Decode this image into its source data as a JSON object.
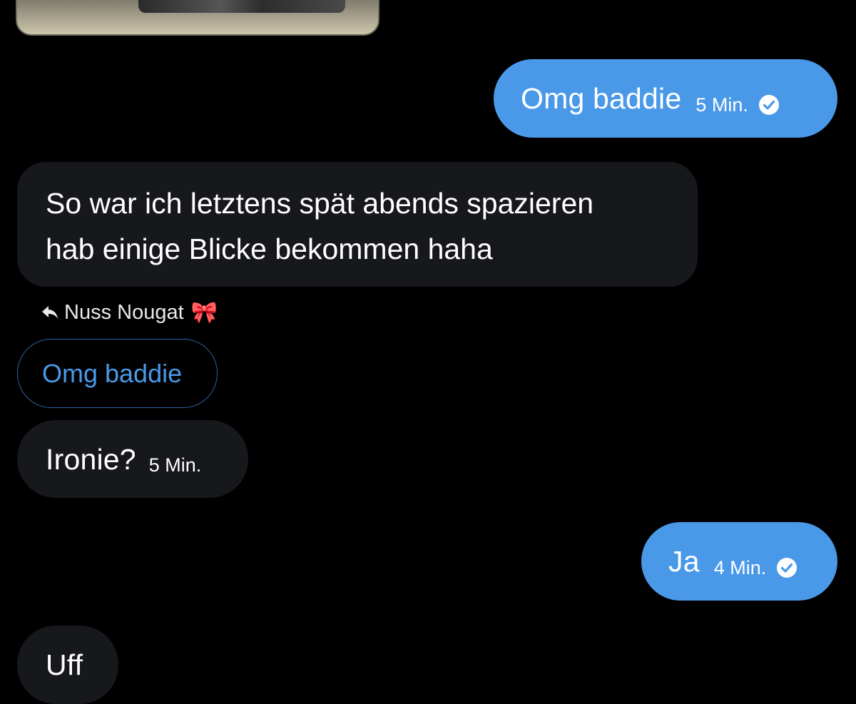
{
  "conversation": {
    "messages": [
      {
        "direction": "outgoing",
        "text": "Omg baddie",
        "time": "5 Min.",
        "status": "sent"
      },
      {
        "direction": "incoming",
        "text_lines": [
          "So war ich letztens spät abends spazieren",
          "hab einige Blicke bekommen haha"
        ]
      },
      {
        "direction": "incoming",
        "reply_to_name": "Nuss Nougat",
        "reply_to_emoji": "🎀",
        "quoted_text": "Omg baddie"
      },
      {
        "direction": "incoming",
        "text": "Ironie?",
        "time": "5 Min."
      },
      {
        "direction": "outgoing",
        "text": "Ja",
        "time": "4 Min.",
        "status": "sent"
      },
      {
        "direction": "incoming",
        "text": "Uff"
      }
    ]
  },
  "icons": {
    "reply": "reply-arrow-icon",
    "sent": "check-circle-icon"
  },
  "colors": {
    "background": "#000000",
    "outgoing_bubble": "#4a99e9",
    "incoming_bubble": "#16181c",
    "accent": "#4a99e9"
  }
}
